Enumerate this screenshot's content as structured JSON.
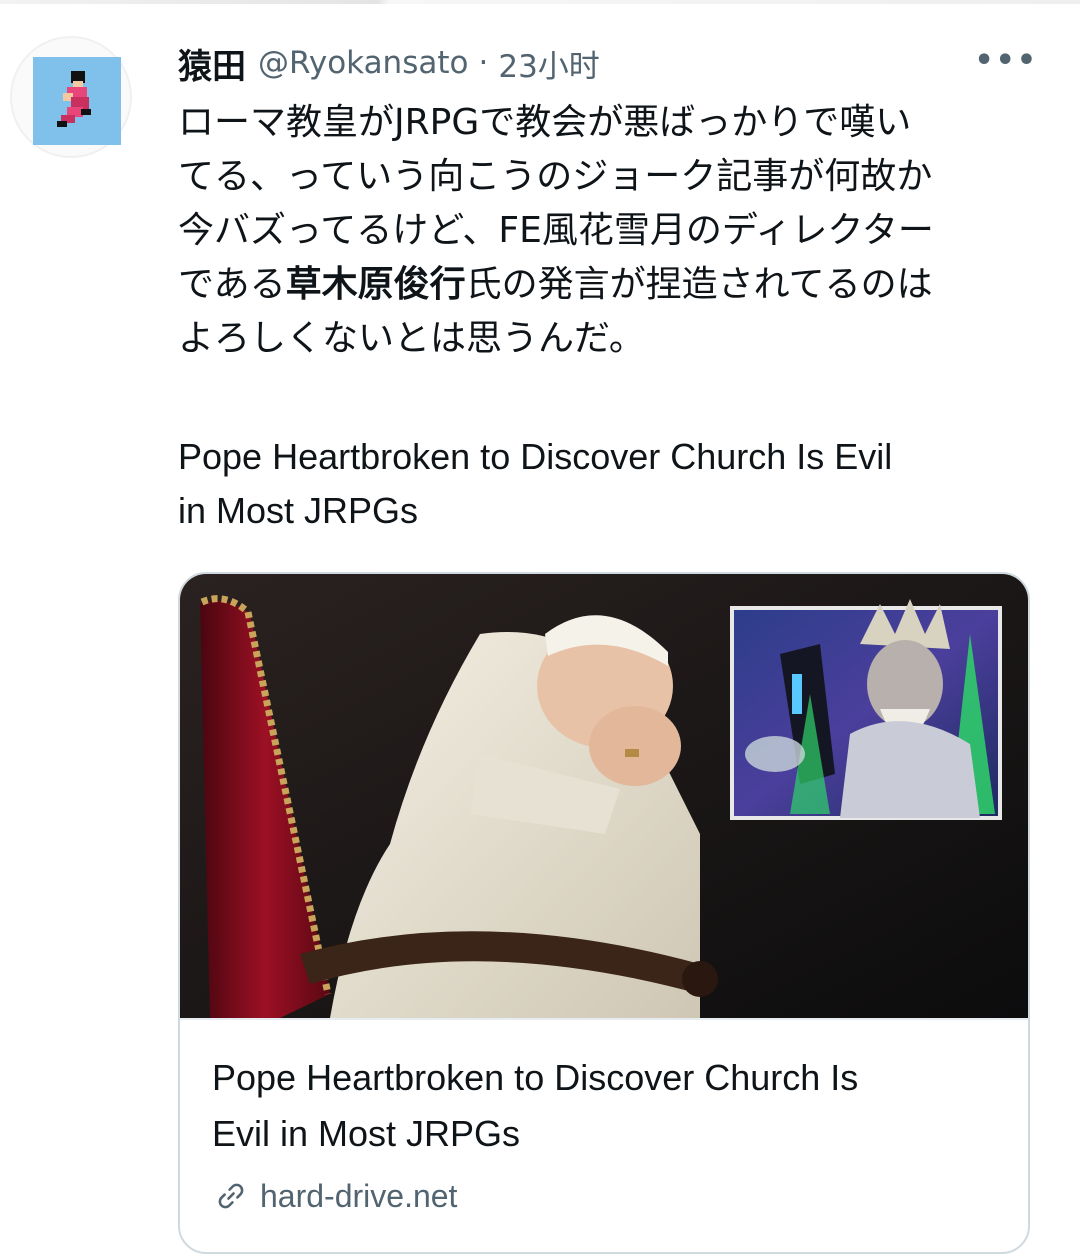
{
  "tweet": {
    "author_name": "猿田",
    "author_handle": "@Ryokansato",
    "separator": "·",
    "timestamp": "23小时",
    "more": "•••",
    "text_lines": [
      {
        "pre": "ローマ教皇がJRPGで教会が悪ばっかりで嘆い",
        "bold": "",
        "post": ""
      },
      {
        "pre": "てる、っていう向こうのジョーク記事が何故か",
        "bold": "",
        "post": ""
      },
      {
        "pre": "今バズってるけど、FE風花雪月のディレクター",
        "bold": "",
        "post": ""
      },
      {
        "pre": "である",
        "bold": "草木原俊行",
        "post": "氏の発言が捏造されてるのは"
      },
      {
        "pre": "よろしくないとは思うんだ。",
        "bold": "",
        "post": ""
      }
    ],
    "headline_lines": [
      "Pope Heartbroken to Discover Church Is Evil",
      "in Most JRPGs"
    ]
  },
  "card": {
    "title_lines": [
      "Pope Heartbroken to Discover Church Is",
      "Evil in Most JRPGs"
    ],
    "domain": "hard-drive.net",
    "link_icon": "link-icon"
  },
  "colors": {
    "text_primary": "#0f1419",
    "text_secondary": "#536471",
    "card_border": "#cfd9de",
    "avatar_bg": "#7fc1ea"
  }
}
